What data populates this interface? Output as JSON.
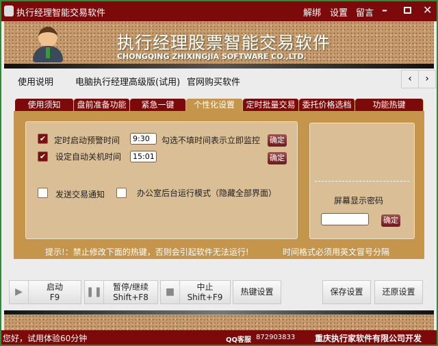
{
  "titlebar": {
    "title": "执行经理智能交易软件",
    "links": [
      "解绑",
      "设置",
      "留言"
    ]
  },
  "banner": {
    "title": "执行经理股票智能交易软件",
    "subtitle": "CHONGQING ZHIXINGJIA SOFTWARE CO.,LTD."
  },
  "menu": [
    "使用说明",
    "电脑执行经理高级版(试用)",
    "官网购买软件"
  ],
  "tabs": [
    "使用须知",
    "盘前准备功能",
    "紧急一键",
    "个性化设置",
    "定时批量交易",
    "委托价格选档",
    "功能热键"
  ],
  "settings": {
    "alarm_label": "定时启动预警时间",
    "alarm_value": "9:30",
    "alarm_note": "勾选不填时间表示立即监控",
    "shutdown_label": "设定自动关机时间",
    "shutdown_value": "15:01",
    "notify_label": "发送交易通知",
    "office_label": "办公室后台运行模式（隐藏全部界面）",
    "ok": "确定",
    "screen_pwd_label": "屏幕显示密码",
    "screen_pwd_value": ""
  },
  "hints": {
    "left": "提示!：禁止修改下面的热键，否则会引起软件无法运行!",
    "right": "时间格式必须用英文冒号分隔"
  },
  "buttons": {
    "start": "启动",
    "start_key": "F9",
    "pause": "暂停/继续",
    "pause_key": "Shift+F8",
    "stop": "中止",
    "stop_key": "Shift+F9",
    "hotkey": "热键设置",
    "save": "保存设置",
    "restore": "还原设置"
  },
  "status": {
    "left": "您好，试用体验60分钟",
    "qq_label": "QQ客服",
    "qq": "872903833",
    "company": "重庆执行家软件有限公司开发"
  }
}
